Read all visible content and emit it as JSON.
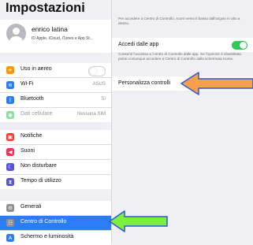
{
  "title": "Impostazioni",
  "profile": {
    "name": "enrico latina",
    "subtitle": "ID Apple, iCloud, iTunes e App St..."
  },
  "groups": [
    [
      {
        "label": "Uso in aereo",
        "icon": "airplane-icon",
        "icon_color": "#ff9500",
        "toggle": "off"
      },
      {
        "label": "Wi-Fi",
        "icon": "wifi-icon",
        "icon_color": "#2c7cf6",
        "value": "ASUS"
      },
      {
        "label": "Bluetooth",
        "icon": "bluetooth-icon",
        "icon_color": "#2c7cf6",
        "value": "Sì"
      },
      {
        "label": "Dati cellulare",
        "icon": "cellular-icon",
        "icon_color": "#8fdca0",
        "value": "Nessuna SIM",
        "dimmed": true
      }
    ],
    [
      {
        "label": "Notifiche",
        "icon": "notifications-icon",
        "icon_color": "#ff3b30"
      },
      {
        "label": "Suoni",
        "icon": "sounds-icon",
        "icon_color": "#ff2d55"
      },
      {
        "label": "Non disturbare",
        "icon": "moon-icon",
        "icon_color": "#5856d6"
      },
      {
        "label": "Tempo di utilizzo",
        "icon": "hourglass-icon",
        "icon_color": "#5856d6"
      }
    ],
    [
      {
        "label": "Generali",
        "icon": "gear-icon",
        "icon_color": "#8e8e93"
      },
      {
        "label": "Centro di Controllo",
        "icon": "control-center-icon",
        "icon_color": "#8e8e93",
        "selected": true
      },
      {
        "label": "Schermo e luminosità",
        "icon": "display-icon",
        "icon_color": "#2c7cf6"
      }
    ]
  ],
  "content": {
    "hint": "Per accedere a Centro di Controllo, scorri verso il basso dall'angolo in alto a destra.",
    "access_label": "Accedi dalle app",
    "access_toggle": "on",
    "access_note": "Consenti l'accesso a Centro di Controllo dalle app. Se l'opzione è disabilitata, potrai comunque accedere a Centro di Controllo dalla schermata Home.",
    "customize_label": "Personalizza controlli"
  },
  "colors": {
    "selection": "#2c7cf6",
    "toggle_on": "#34c759",
    "annotation_arrow_fill": "#7cf03c",
    "annotation_arrow_fill_alt": "#f5a04a",
    "annotation_arrow_stroke": "#2a5bd7"
  }
}
